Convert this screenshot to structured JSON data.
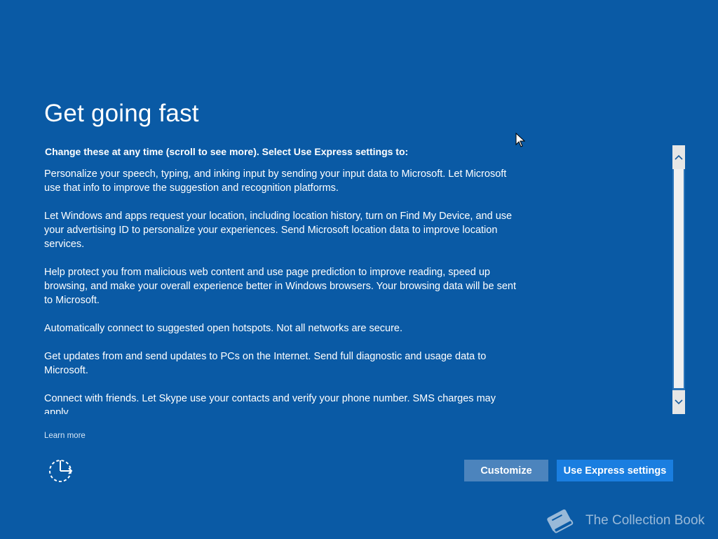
{
  "colors": {
    "background": "#0a5aa5",
    "customize_button": "#4c84bd",
    "express_button": "#1a7ee0",
    "text": "#ffffff"
  },
  "page": {
    "title": "Get going fast",
    "subtitle": "Change these at any time (scroll to see more). Select Use Express settings to:"
  },
  "paragraphs": [
    "Personalize your speech, typing, and inking input by sending your input data to Microsoft. Let Microsoft use that info to improve the suggestion and recognition platforms.",
    "Let Windows and apps request your location, including location history, turn on Find My Device, and use your advertising ID to personalize your experiences. Send Microsoft location data to improve location services.",
    "Help protect you from malicious web content and use page prediction to improve reading, speed up browsing, and make your overall experience better in Windows browsers. Your browsing data will be sent to Microsoft.",
    "Automatically connect to suggested open hotspots. Not all networks are secure.",
    "Get updates from and send updates to PCs on the Internet. Send full diagnostic and usage data to Microsoft.",
    "Connect with friends. Let Skype use your contacts and verify your phone number. SMS charges may apply."
  ],
  "links": {
    "learn_more": "Learn more"
  },
  "buttons": {
    "customize": "Customize",
    "express": "Use Express settings"
  },
  "icons": {
    "ease_of_access": "ease-of-access-icon",
    "scroll_up": "chevron-up-icon",
    "scroll_down": "chevron-down-icon",
    "watermark_logo": "book-icon"
  },
  "watermark": {
    "text": "The Collection Book"
  }
}
